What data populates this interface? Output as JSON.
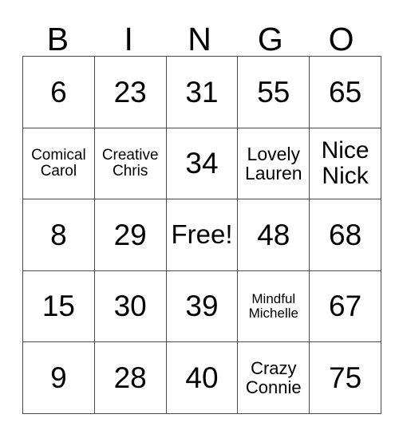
{
  "card": {
    "headers": [
      "B",
      "I",
      "N",
      "G",
      "O"
    ],
    "rows": [
      [
        {
          "text": "6",
          "size": "fs-num"
        },
        {
          "text": "23",
          "size": "fs-num"
        },
        {
          "text": "31",
          "size": "fs-num"
        },
        {
          "text": "55",
          "size": "fs-num"
        },
        {
          "text": "65",
          "size": "fs-num"
        }
      ],
      [
        {
          "text": "Comical Carol",
          "size": "fs-sm"
        },
        {
          "text": "Creative Chris",
          "size": "fs-sm"
        },
        {
          "text": "34",
          "size": "fs-num"
        },
        {
          "text": "Lovely Lauren",
          "size": "fs-lg"
        },
        {
          "text": "Nice Nick",
          "size": "fs-xl"
        }
      ],
      [
        {
          "text": "8",
          "size": "fs-num"
        },
        {
          "text": "29",
          "size": "fs-num"
        },
        {
          "text": "Free!",
          "size": "fs-free"
        },
        {
          "text": "48",
          "size": "fs-num"
        },
        {
          "text": "68",
          "size": "fs-num"
        }
      ],
      [
        {
          "text": "15",
          "size": "fs-num"
        },
        {
          "text": "30",
          "size": "fs-num"
        },
        {
          "text": "39",
          "size": "fs-num"
        },
        {
          "text": "Mindful Michelle",
          "size": "fs-xs"
        },
        {
          "text": "67",
          "size": "fs-num"
        }
      ],
      [
        {
          "text": "9",
          "size": "fs-num"
        },
        {
          "text": "28",
          "size": "fs-num"
        },
        {
          "text": "40",
          "size": "fs-num"
        },
        {
          "text": "Crazy Connie",
          "size": "fs-md"
        },
        {
          "text": "75",
          "size": "fs-num"
        }
      ]
    ],
    "colors": {
      "background": "#ffffff",
      "border": "#4a4a4a",
      "text": "#000000"
    }
  }
}
